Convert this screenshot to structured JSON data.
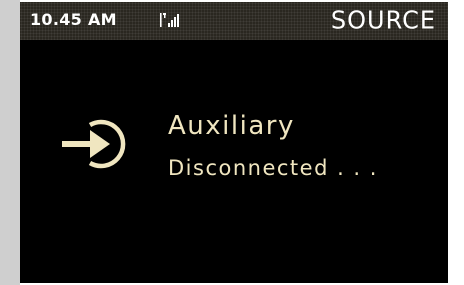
{
  "status_bar": {
    "time": "10.45 AM",
    "signal_icon": "signal-bars-icon",
    "title": "SOURCE"
  },
  "source": {
    "icon": "aux-input-icon",
    "name": "Auxiliary",
    "status": "Disconnected . . ."
  },
  "colors": {
    "screen_bg": "#000000",
    "text_accent": "#f0e6c0",
    "statusbar_bg": "#2a2720"
  }
}
